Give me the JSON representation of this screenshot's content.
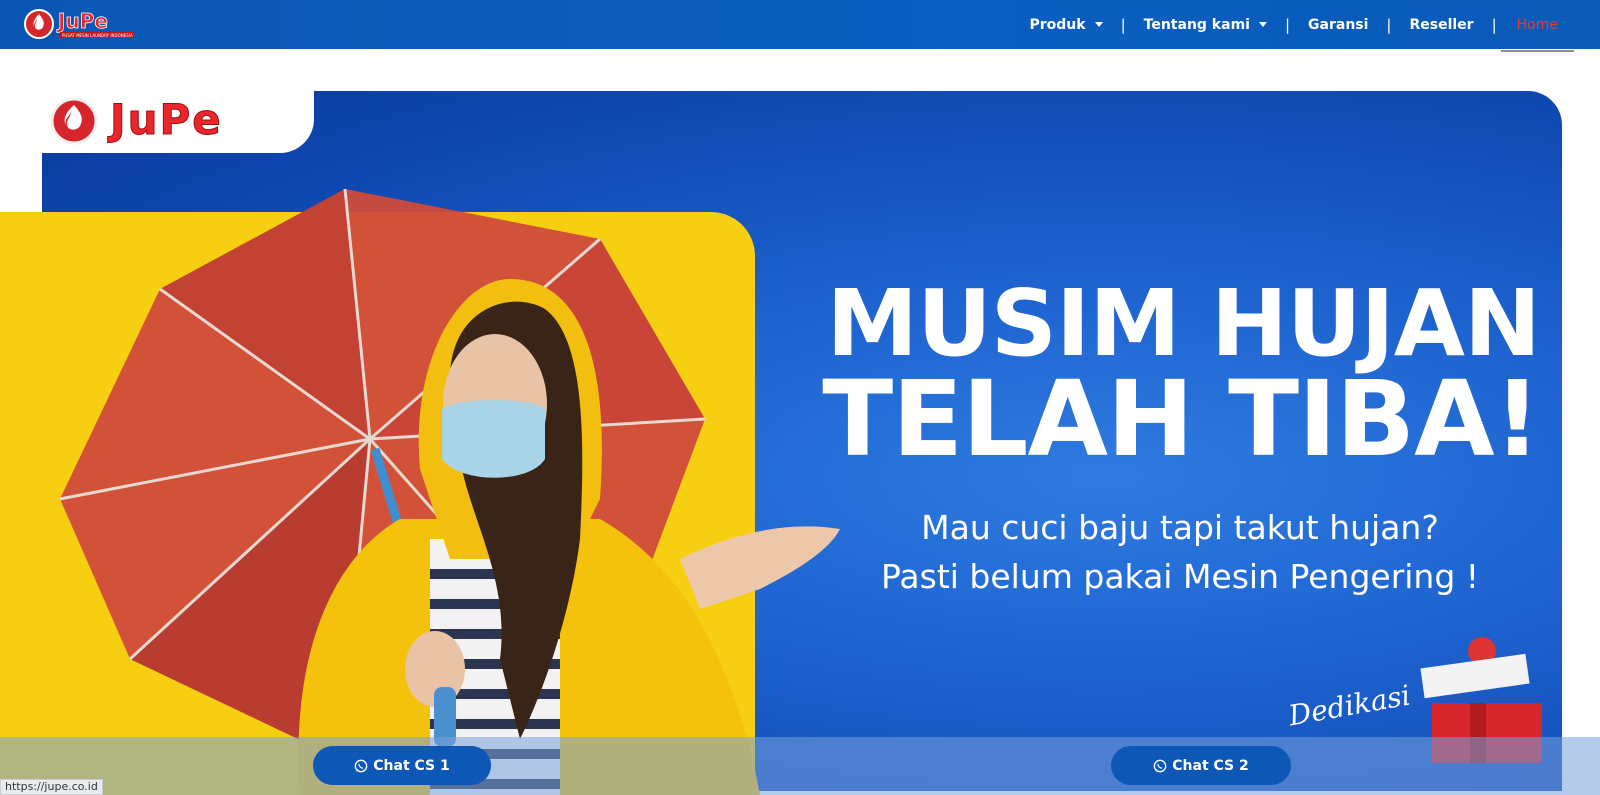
{
  "brand": {
    "name": "JuPe",
    "tagline": "PUSAT MESIN LAUNDRY INDONESIA"
  },
  "nav": {
    "items": [
      {
        "label": "Produk",
        "dropdown": true
      },
      {
        "label": "Tentang kami",
        "dropdown": true
      },
      {
        "label": "Garansi",
        "dropdown": false
      },
      {
        "label": "Reseller",
        "dropdown": false
      },
      {
        "label": "Home",
        "active": true
      }
    ],
    "separator": "|"
  },
  "hero": {
    "headline_line1": "MUSIM HUJAN",
    "headline_line2": "TELAH TIBA!",
    "sub_line1": "Mau cuci baju tapi takut hujan?",
    "sub_line2": "Pasti belum pakai Mesin Pengering !",
    "badge_text": "Dedikasi",
    "colors": {
      "blue": "#1e63d0",
      "yellow": "#f6cf12",
      "accent_red": "#e53935"
    }
  },
  "chat": {
    "cs1_label": "Chat CS 1",
    "cs2_label": "Chat CS 2",
    "icon": "whatsapp-icon"
  },
  "status_bar": {
    "url": "https://jupe.co.id"
  }
}
